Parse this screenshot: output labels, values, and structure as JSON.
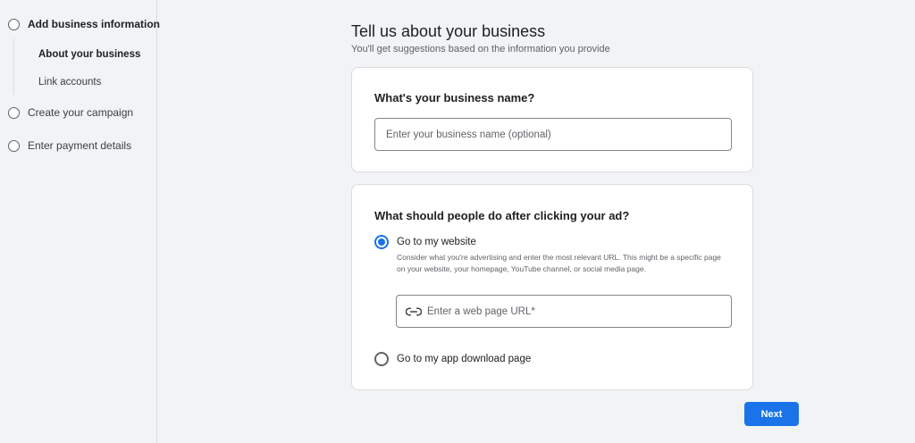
{
  "sidebar": {
    "steps": [
      {
        "label": "Add business information",
        "icon": "step-circle-icon"
      },
      {
        "label": "Create your campaign",
        "icon": "step-circle-icon"
      },
      {
        "label": "Enter payment details",
        "icon": "step-circle-icon"
      }
    ],
    "substeps": [
      {
        "label": "About your business",
        "active": true
      },
      {
        "label": "Link accounts",
        "active": false
      }
    ]
  },
  "main": {
    "title": "Tell us about your business",
    "subtitle": "You'll get suggestions based on the information you provide",
    "business_card": {
      "question": "What's your business name?",
      "input_value": "",
      "input_placeholder": "Enter your business name (optional)"
    },
    "action_card": {
      "question": "What should people do after clicking your ad?",
      "options": [
        {
          "label": "Go to my website",
          "selected": true,
          "description": "Consider what you're advertising and enter the most relevant URL. This might be a specific page on your website, your homepage, YouTube channel, or social media page."
        },
        {
          "label": "Go to my app download page",
          "selected": false
        }
      ],
      "url_input_value": "",
      "url_input_placeholder": "Enter a web page URL*",
      "url_icon": "link-icon"
    }
  },
  "footer": {
    "next_label": "Next"
  },
  "colors": {
    "accent": "#1a73e8",
    "background": "#f1f3f4",
    "card": "#ffffff"
  }
}
